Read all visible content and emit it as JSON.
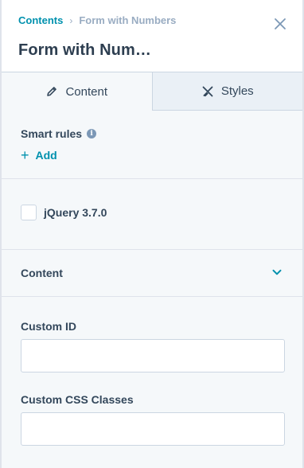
{
  "breadcrumb": {
    "root": "Contents",
    "separator": "›",
    "current": "Form with Numbers"
  },
  "header": {
    "title": "Form with Num…",
    "close_icon": "close-icon"
  },
  "tabs": [
    {
      "label": "Content",
      "icon": "pencil-icon",
      "active": true
    },
    {
      "label": "Styles",
      "icon": "brush-icon",
      "active": false
    }
  ],
  "smart_rules": {
    "label": "Smart rules",
    "info_glyph": "i",
    "add_label": "Add",
    "add_glyph": "+"
  },
  "jquery": {
    "label": "jQuery 3.7.0",
    "checked": false
  },
  "content_section": {
    "label": "Content",
    "expanded": true
  },
  "fields": {
    "custom_id": {
      "label": "Custom ID",
      "value": ""
    },
    "custom_css": {
      "label": "Custom CSS Classes",
      "value": ""
    }
  },
  "colors": {
    "accent": "#0091ae",
    "text": "#33475b",
    "panel_bg": "#f5f8fa",
    "inactive_tab_bg": "#eaf0f6"
  }
}
